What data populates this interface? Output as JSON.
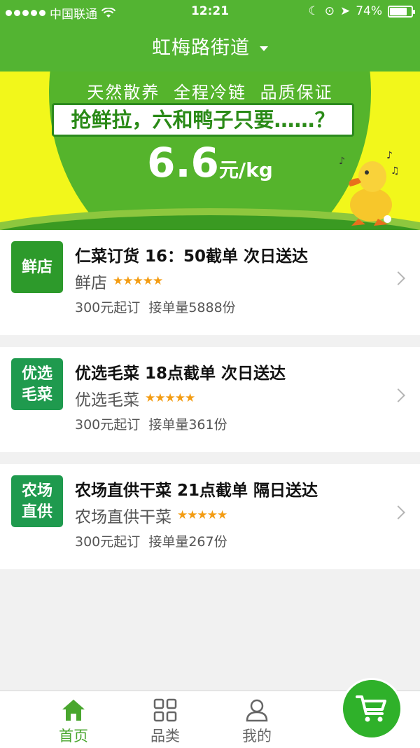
{
  "status_bar": {
    "carrier": "中国联通",
    "time": "12:21",
    "battery_pct": "74%"
  },
  "header": {
    "title": "虹梅路街道"
  },
  "banner": {
    "tagline": "天然散养 全程冷链 品质保证",
    "slogan": "抢鲜拉，六和鸭子只要……？",
    "price": "6.6",
    "price_unit": "元/kg"
  },
  "stores": [
    {
      "logo": "鲜店",
      "title": "仁菜订货 16：50截单 次日送达",
      "name": "鲜店",
      "rating": "★★★★★",
      "min_order": "300元起订",
      "orders": "接单量5888份"
    },
    {
      "logo": "优选毛菜",
      "title": "优选毛菜 18点截单 次日送达",
      "name": "优选毛菜",
      "rating": "★★★★★",
      "min_order": "300元起订",
      "orders": "接单量361份"
    },
    {
      "logo": "农场直供",
      "title": "农场直供干菜 21点截单 隔日送达",
      "name": "农场直供干菜",
      "rating": "★★★★★",
      "min_order": "300元起订",
      "orders": "接单量267份"
    }
  ],
  "tabs": [
    {
      "label": "首页",
      "icon": "home-icon"
    },
    {
      "label": "品类",
      "icon": "grid-icon"
    },
    {
      "label": "我的",
      "icon": "user-icon"
    }
  ],
  "colors": {
    "brand_green": "#53b432",
    "banner_yellow": "#f2f71b",
    "star_orange": "#f39c12"
  }
}
